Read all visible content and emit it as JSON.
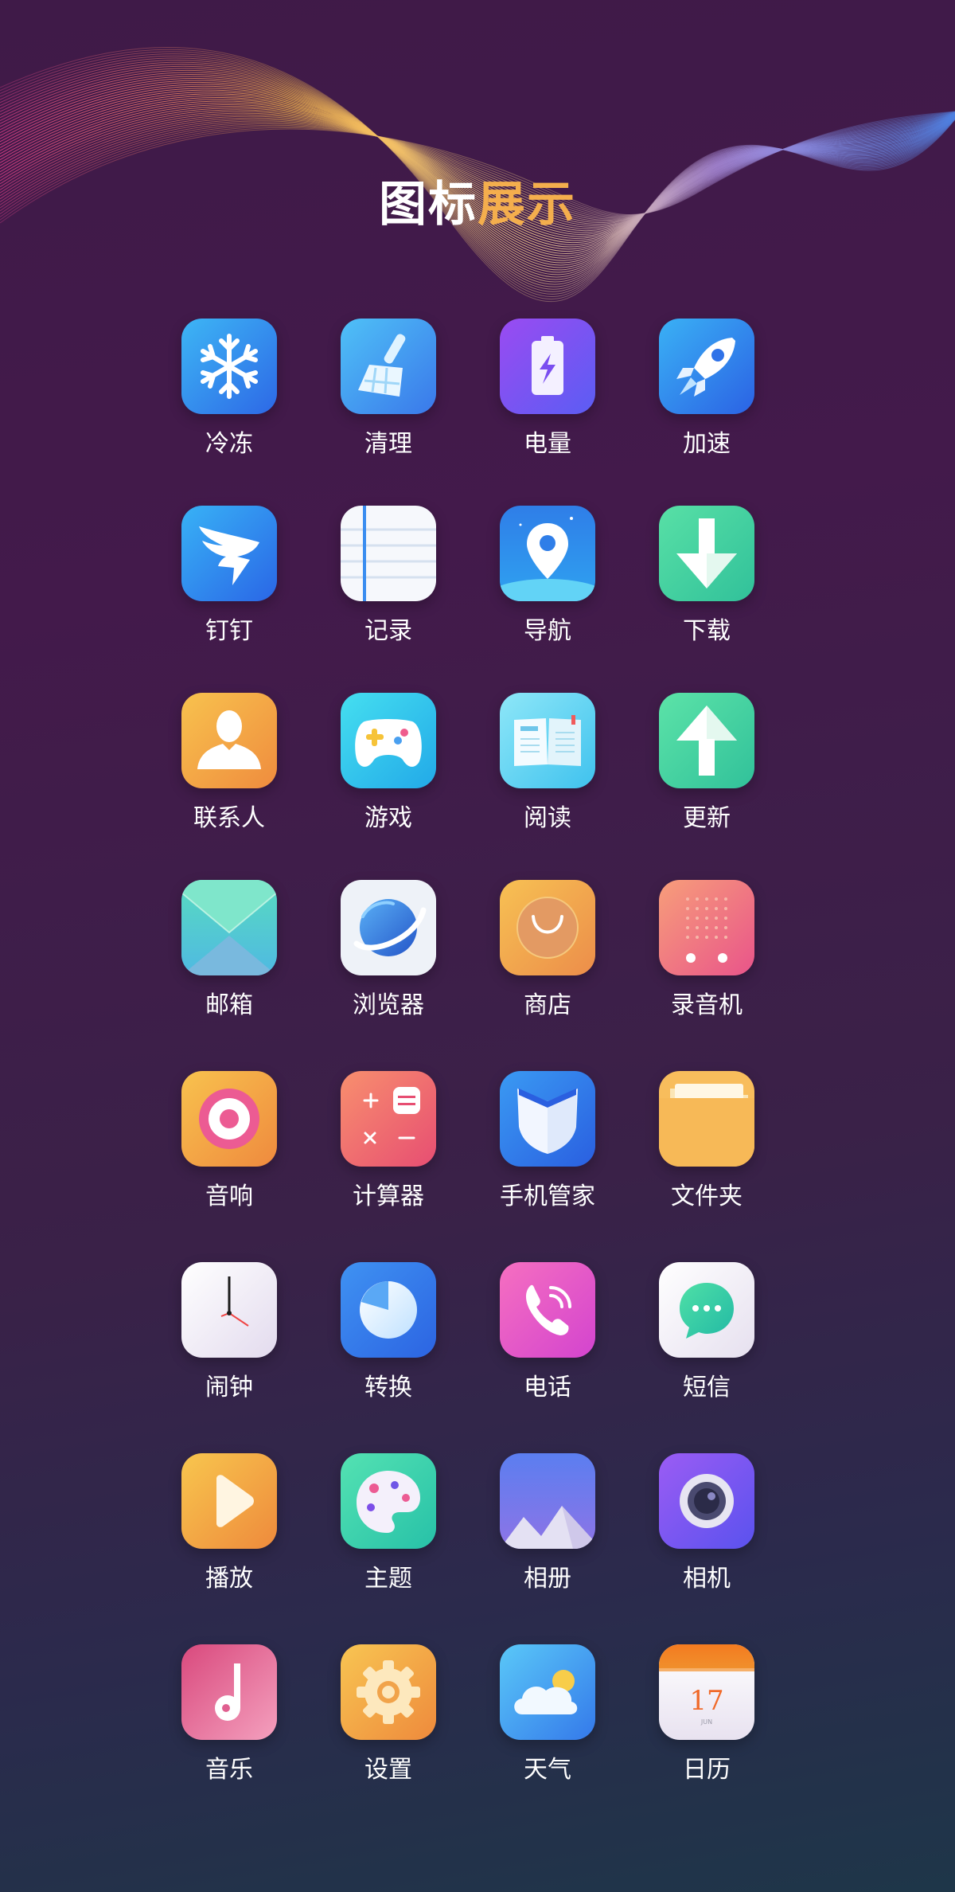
{
  "title": {
    "part1": "图标",
    "part2": "展示"
  },
  "apps": [
    {
      "label": "冷冻",
      "icon": "snowflake-icon"
    },
    {
      "label": "清理",
      "icon": "broom-icon"
    },
    {
      "label": "电量",
      "icon": "battery-icon"
    },
    {
      "label": "加速",
      "icon": "rocket-icon"
    },
    {
      "label": "钉钉",
      "icon": "dingtalk-wing-icon"
    },
    {
      "label": "记录",
      "icon": "notepad-icon"
    },
    {
      "label": "导航",
      "icon": "map-pin-icon"
    },
    {
      "label": "下载",
      "icon": "down-arrow-icon"
    },
    {
      "label": "联系人",
      "icon": "person-icon"
    },
    {
      "label": "游戏",
      "icon": "gamepad-icon"
    },
    {
      "label": "阅读",
      "icon": "open-book-icon"
    },
    {
      "label": "更新",
      "icon": "up-arrow-icon"
    },
    {
      "label": "邮箱",
      "icon": "envelope-icon"
    },
    {
      "label": "浏览器",
      "icon": "planet-globe-icon"
    },
    {
      "label": "商店",
      "icon": "shopping-bag-icon"
    },
    {
      "label": "录音机",
      "icon": "recorder-grille-icon"
    },
    {
      "label": "音响",
      "icon": "speaker-icon"
    },
    {
      "label": "计算器",
      "icon": "calculator-icon"
    },
    {
      "label": "手机管家",
      "icon": "shield-icon"
    },
    {
      "label": "文件夹",
      "icon": "folder-icon"
    },
    {
      "label": "闹钟",
      "icon": "clock-icon"
    },
    {
      "label": "转换",
      "icon": "pie-dial-icon"
    },
    {
      "label": "电话",
      "icon": "phone-icon"
    },
    {
      "label": "短信",
      "icon": "chat-bubble-icon"
    },
    {
      "label": "播放",
      "icon": "play-icon"
    },
    {
      "label": "主题",
      "icon": "palette-icon"
    },
    {
      "label": "相册",
      "icon": "mountain-photo-icon"
    },
    {
      "label": "相机",
      "icon": "camera-lens-icon"
    },
    {
      "label": "音乐",
      "icon": "music-note-icon"
    },
    {
      "label": "设置",
      "icon": "gear-icon"
    },
    {
      "label": "天气",
      "icon": "cloud-sun-icon"
    },
    {
      "label": "日历",
      "icon": "calendar-icon"
    }
  ],
  "calendar_icon": {
    "day": "17",
    "month": "JUN"
  },
  "colors": {
    "title_accent": "#f4ae4d",
    "label": "#ffffff",
    "background_top": "#431a4b",
    "background_bottom": "#1e3649"
  }
}
